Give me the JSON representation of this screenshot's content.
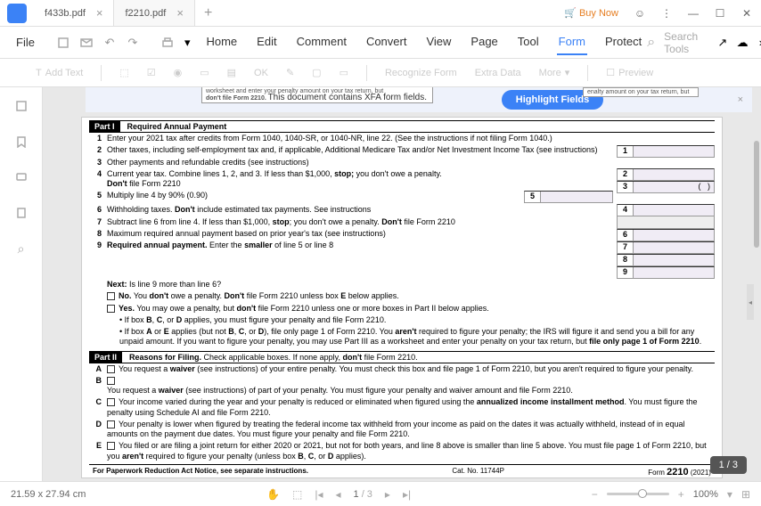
{
  "titlebar": {
    "tabs": [
      {
        "label": "f433b.pdf",
        "active": false
      },
      {
        "label": "f2210.pdf",
        "active": true
      }
    ],
    "buy_now": "Buy Now"
  },
  "menubar": {
    "file": "File",
    "items": [
      "Home",
      "Edit",
      "Comment",
      "Convert",
      "View",
      "Page",
      "Tool",
      "Form",
      "Protect"
    ],
    "active_index": 7,
    "search": "Search Tools"
  },
  "toolbar": {
    "add_text": "Add Text",
    "recognize": "Recognize Form",
    "extra_data": "Extra Data",
    "more": "More",
    "preview": "Preview"
  },
  "banner": {
    "left_warn": "worksheet and enter your penalty amount on your tax return, but",
    "left_warn2": "don't file Form 2210.",
    "msg": "This document contains XFA form fields.",
    "btn": "Highlight Fields",
    "right_warn": "enalty amount on your tax return, but"
  },
  "form": {
    "part1": {
      "label": "Part I",
      "title": "Required Annual Payment"
    },
    "lines": {
      "l1": "Enter your 2021 tax after credits from Form 1040, 1040-SR, or 1040-NR, line 22. (See the instructions if not filing Form 1040.)",
      "l2": "Other taxes, including self-employment tax and, if applicable, Additional Medicare Tax and/or Net Investment Income Tax (see instructions)",
      "l3": "Other payments and refundable credits (see instructions)",
      "l4a": "Current year tax. Combine lines 1, 2, and 3. If less than $1,000, ",
      "l4b": "stop;",
      "l4c": " you don't owe a penalty.",
      "l4d": "Don't",
      "l4e": " file Form 2210",
      "l5": "Multiply line 4 by 90% (0.90)",
      "l6a": "Withholding taxes. ",
      "l6b": "Don't",
      "l6c": " include estimated tax payments. See instructions",
      "l7a": "Subtract line 6 from line 4. If less than $1,000, ",
      "l7b": "stop",
      "l7c": "; you don't owe a penalty. ",
      "l7d": "Don't",
      "l7e": " file Form 2210",
      "l8": "Maximum required annual payment based on prior year's tax (see instructions)",
      "l9a": "Required annual payment.",
      "l9b": " Enter the ",
      "l9c": "smaller",
      "l9d": " of line 5 or line 8",
      "next": "Next:",
      "next_txt": " Is line 9 more than line 6?",
      "no": "No.",
      "no_txt": " You ",
      "dont": "don't",
      "no_txt2": " owe a penalty. ",
      "no_txt3": " file Form 2210 unless box ",
      "E": "E",
      "no_txt4": " below applies.",
      "yes": "Yes.",
      "yes_txt": " You may owe a penalty, but ",
      "yes_txt2": " file Form 2210 unless one or more boxes in Part II below applies.",
      "b1a": "• If box ",
      "B": "B",
      "C": "C",
      "D": "D",
      "or": ", or ",
      "b1b": " applies, you must figure your penalty and file Form 2210.",
      "b2a": "• If box ",
      "A": "A",
      "b2b": " applies (but not ",
      "b2c": "), file only page 1 of Form 2210. You ",
      "arent": "aren't",
      "b2d": " required to figure your penalty; the IRS will figure it and send you a bill for any unpaid amount. If you want to figure your penalty, you may use Part III as a worksheet and enter your penalty on your tax return, but ",
      "b2e": "file only page 1 of Form 2210",
      "dot": "."
    },
    "part2": {
      "label": "Part II",
      "title": "Reasons for Filing.",
      "sub": " Check applicable boxes. If none apply, ",
      "dont": "don't",
      "sub2": " file Form 2210."
    },
    "reasons": {
      "A1": "You request a ",
      "waiver": "waiver",
      "A2": " (see instructions) of your entire penalty. You must check this box and file page 1 of Form 2210, but you aren't required to figure your penalty.",
      "B1": "You request a ",
      "B2": " (see instructions) of part of your penalty. You must figure your penalty and waiver amount and file Form 2210.",
      "C1": "Your income varied during the year and your penalty is reduced or eliminated when figured using the ",
      "C2": "annualized income installment method",
      "C3": ". You must figure the penalty using Schedule AI and file Form 2210.",
      "D1": "Your penalty is lower when figured by treating the federal income tax withheld from your income as paid on the dates it was actually withheld, instead of in equal amounts on the payment due dates. You must figure your penalty and file Form 2210.",
      "E1": "You filed or are filing a joint return for either 2020 or 2021, but not for both years, and line 8 above is smaller than line 5 above. You must file page 1 of Form 2210, but you ",
      "E2": " required to figure your penalty (unless box ",
      "E3": " applies)."
    },
    "footer": {
      "left": "For Paperwork Reduction Act Notice, see separate instructions.",
      "mid": "Cat. No. 11744P",
      "right_form": "Form ",
      "right_num": "2210",
      "right_year": " (2021)"
    }
  },
  "pagebadge": "1 / 3",
  "statusbar": {
    "dims": "21.59 x 27.94 cm",
    "page_current": "1",
    "page_total": "/ 3",
    "zoom": "100%"
  }
}
